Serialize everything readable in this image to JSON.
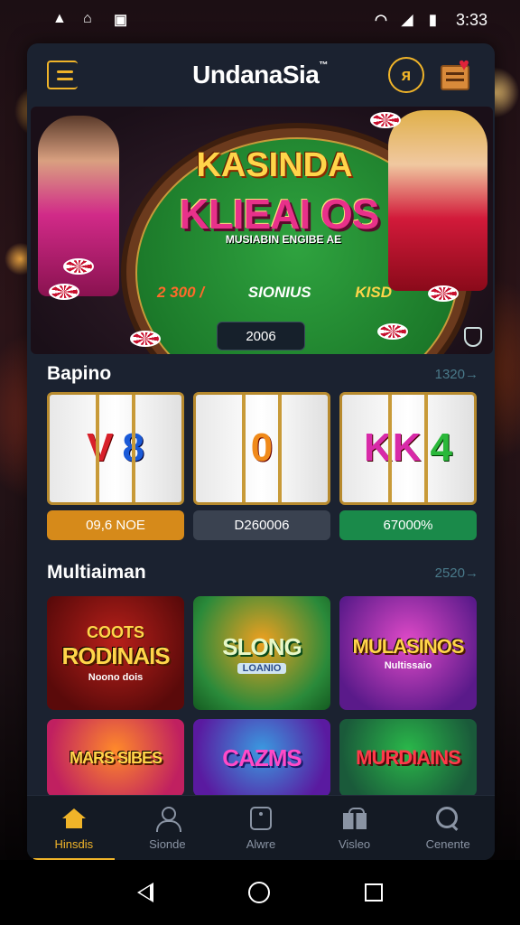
{
  "status_bar": {
    "time": "3:33",
    "left_icons": [
      "warning-icon",
      "app-icon",
      "notification-icon"
    ],
    "right_icons": [
      "wifi-icon",
      "signal-icon",
      "battery-icon"
    ]
  },
  "header": {
    "title": "UndanaSia",
    "trademark": "™"
  },
  "hero": {
    "title_top": "KASINDA",
    "title_main": "KLIEAI OS",
    "subtitle": "MUSIABIN ENGIBE AE",
    "stat_1": "2 300 /",
    "stat_2": "SIONIUS",
    "stat_3": "KISD",
    "badge": "2006"
  },
  "section_1": {
    "title": "Bapino",
    "link": "1320→"
  },
  "slots": [
    {
      "symbols": [
        "V",
        "8"
      ],
      "value": "09,6 NOE",
      "tone": "orange"
    },
    {
      "symbols": [
        "0"
      ],
      "value": "D260006",
      "tone": "gray"
    },
    {
      "symbols": [
        "KK",
        "4"
      ],
      "value": "67000%",
      "tone": "green"
    }
  ],
  "section_2": {
    "title": "Multiaiman",
    "link": "2520→"
  },
  "games": [
    {
      "pre": "COOTS",
      "title": "RODINAIS",
      "sub": "Noono dois"
    },
    {
      "pre": "",
      "title": "SLONG",
      "sub": "LOANIO"
    },
    {
      "pre": "",
      "title": "MULASINOS",
      "sub": "Nultissaio"
    },
    {
      "pre": "",
      "title": "MARS SIBES",
      "sub": ""
    },
    {
      "pre": "",
      "title": "CAZMS",
      "sub": ""
    },
    {
      "pre": "",
      "title": "MURDIAINS",
      "sub": ""
    }
  ],
  "bottom_nav": [
    {
      "label": "Hinsdis",
      "icon": "home-icon",
      "active": true
    },
    {
      "label": "Sionde",
      "icon": "user-icon",
      "active": false
    },
    {
      "label": "Alwre",
      "icon": "square-icon",
      "active": false
    },
    {
      "label": "Visleo",
      "icon": "gift-icon",
      "active": false
    },
    {
      "label": "Cenente",
      "icon": "search-icon",
      "active": false
    }
  ],
  "colors": {
    "accent": "#f0b429",
    "app_bg": "#1b2230",
    "nav_bg": "#141a24"
  }
}
